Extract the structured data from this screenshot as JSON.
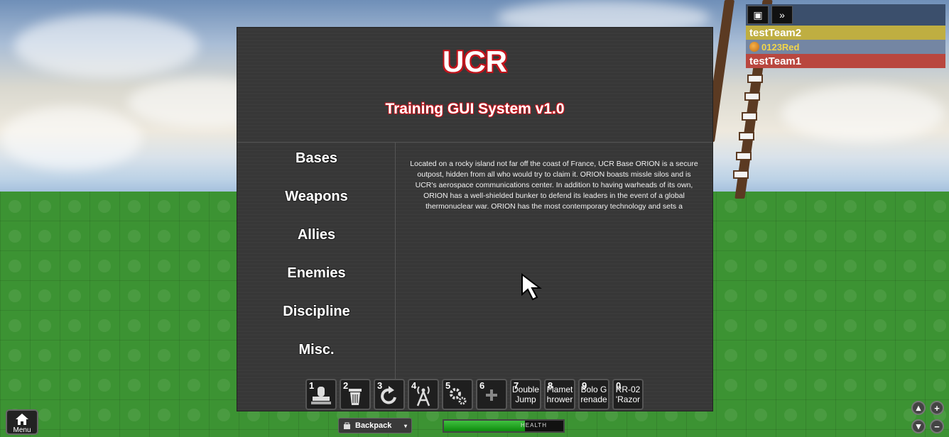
{
  "gui": {
    "title": "UCR",
    "subtitle": "Training GUI System v1.0",
    "menu": [
      "Bases",
      "Weapons",
      "Allies",
      "Enemies",
      "Discipline",
      "Misc."
    ],
    "description": "Located on a rocky island not far off the coast of France, UCR Base ORION is a secure outpost, hidden from all who would try to claim it. ORION boasts missle silos and is UCR's aerospace communications center. In addition to having warheads of its own, ORION has a well-shielded bunker to defend its leaders in the event of a global thermonuclear war. ORION has the most contemporary technology and sets a"
  },
  "hotbar": [
    {
      "num": "1",
      "icon": "stamp-icon",
      "label": ""
    },
    {
      "num": "2",
      "icon": "trash-icon",
      "label": ""
    },
    {
      "num": "3",
      "icon": "rotate-icon",
      "label": ""
    },
    {
      "num": "4",
      "icon": "antenna-icon",
      "label": ""
    },
    {
      "num": "5",
      "icon": "gears-icon",
      "label": ""
    },
    {
      "num": "6",
      "icon": "plus-icon",
      "label": ""
    },
    {
      "num": "7",
      "icon": "",
      "label": "Double Jump"
    },
    {
      "num": "8",
      "icon": "",
      "label": "Flamethrower"
    },
    {
      "num": "9",
      "icon": "",
      "label": "Bolo Grenade"
    },
    {
      "num": "0",
      "icon": "",
      "label": "RR-02 'Razor"
    }
  ],
  "players": {
    "teams": [
      {
        "name": "testTeam2",
        "color": "#bfae41"
      },
      {
        "name": "0123Red",
        "color": "#7486a3"
      },
      {
        "name": "testTeam1",
        "color": "#b9473f"
      }
    ]
  },
  "hud": {
    "menu_label": "Menu",
    "backpack_label": "Backpack",
    "health_label": "HEALTH",
    "health_fraction": 0.68
  },
  "colors": {
    "accent_red": "#c3141c",
    "health_green": "#1ea81e"
  }
}
